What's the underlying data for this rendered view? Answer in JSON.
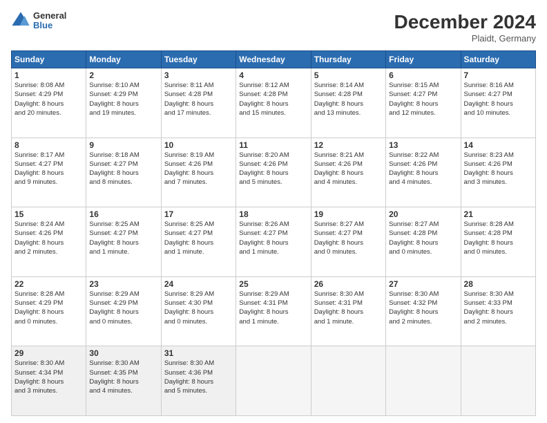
{
  "header": {
    "logo_general": "General",
    "logo_blue": "Blue",
    "month_title": "December 2024",
    "location": "Plaidt, Germany"
  },
  "days_of_week": [
    "Sunday",
    "Monday",
    "Tuesday",
    "Wednesday",
    "Thursday",
    "Friday",
    "Saturday"
  ],
  "weeks": [
    [
      {
        "day": "1",
        "lines": [
          "Sunrise: 8:08 AM",
          "Sunset: 4:29 PM",
          "Daylight: 8 hours",
          "and 20 minutes."
        ]
      },
      {
        "day": "2",
        "lines": [
          "Sunrise: 8:10 AM",
          "Sunset: 4:29 PM",
          "Daylight: 8 hours",
          "and 19 minutes."
        ]
      },
      {
        "day": "3",
        "lines": [
          "Sunrise: 8:11 AM",
          "Sunset: 4:28 PM",
          "Daylight: 8 hours",
          "and 17 minutes."
        ]
      },
      {
        "day": "4",
        "lines": [
          "Sunrise: 8:12 AM",
          "Sunset: 4:28 PM",
          "Daylight: 8 hours",
          "and 15 minutes."
        ]
      },
      {
        "day": "5",
        "lines": [
          "Sunrise: 8:14 AM",
          "Sunset: 4:28 PM",
          "Daylight: 8 hours",
          "and 13 minutes."
        ]
      },
      {
        "day": "6",
        "lines": [
          "Sunrise: 8:15 AM",
          "Sunset: 4:27 PM",
          "Daylight: 8 hours",
          "and 12 minutes."
        ]
      },
      {
        "day": "7",
        "lines": [
          "Sunrise: 8:16 AM",
          "Sunset: 4:27 PM",
          "Daylight: 8 hours",
          "and 10 minutes."
        ]
      }
    ],
    [
      {
        "day": "8",
        "lines": [
          "Sunrise: 8:17 AM",
          "Sunset: 4:27 PM",
          "Daylight: 8 hours",
          "and 9 minutes."
        ]
      },
      {
        "day": "9",
        "lines": [
          "Sunrise: 8:18 AM",
          "Sunset: 4:27 PM",
          "Daylight: 8 hours",
          "and 8 minutes."
        ]
      },
      {
        "day": "10",
        "lines": [
          "Sunrise: 8:19 AM",
          "Sunset: 4:26 PM",
          "Daylight: 8 hours",
          "and 7 minutes."
        ]
      },
      {
        "day": "11",
        "lines": [
          "Sunrise: 8:20 AM",
          "Sunset: 4:26 PM",
          "Daylight: 8 hours",
          "and 5 minutes."
        ]
      },
      {
        "day": "12",
        "lines": [
          "Sunrise: 8:21 AM",
          "Sunset: 4:26 PM",
          "Daylight: 8 hours",
          "and 4 minutes."
        ]
      },
      {
        "day": "13",
        "lines": [
          "Sunrise: 8:22 AM",
          "Sunset: 4:26 PM",
          "Daylight: 8 hours",
          "and 4 minutes."
        ]
      },
      {
        "day": "14",
        "lines": [
          "Sunrise: 8:23 AM",
          "Sunset: 4:26 PM",
          "Daylight: 8 hours",
          "and 3 minutes."
        ]
      }
    ],
    [
      {
        "day": "15",
        "lines": [
          "Sunrise: 8:24 AM",
          "Sunset: 4:26 PM",
          "Daylight: 8 hours",
          "and 2 minutes."
        ]
      },
      {
        "day": "16",
        "lines": [
          "Sunrise: 8:25 AM",
          "Sunset: 4:27 PM",
          "Daylight: 8 hours",
          "and 1 minute."
        ]
      },
      {
        "day": "17",
        "lines": [
          "Sunrise: 8:25 AM",
          "Sunset: 4:27 PM",
          "Daylight: 8 hours",
          "and 1 minute."
        ]
      },
      {
        "day": "18",
        "lines": [
          "Sunrise: 8:26 AM",
          "Sunset: 4:27 PM",
          "Daylight: 8 hours",
          "and 1 minute."
        ]
      },
      {
        "day": "19",
        "lines": [
          "Sunrise: 8:27 AM",
          "Sunset: 4:27 PM",
          "Daylight: 8 hours",
          "and 0 minutes."
        ]
      },
      {
        "day": "20",
        "lines": [
          "Sunrise: 8:27 AM",
          "Sunset: 4:28 PM",
          "Daylight: 8 hours",
          "and 0 minutes."
        ]
      },
      {
        "day": "21",
        "lines": [
          "Sunrise: 8:28 AM",
          "Sunset: 4:28 PM",
          "Daylight: 8 hours",
          "and 0 minutes."
        ]
      }
    ],
    [
      {
        "day": "22",
        "lines": [
          "Sunrise: 8:28 AM",
          "Sunset: 4:29 PM",
          "Daylight: 8 hours",
          "and 0 minutes."
        ]
      },
      {
        "day": "23",
        "lines": [
          "Sunrise: 8:29 AM",
          "Sunset: 4:29 PM",
          "Daylight: 8 hours",
          "and 0 minutes."
        ]
      },
      {
        "day": "24",
        "lines": [
          "Sunrise: 8:29 AM",
          "Sunset: 4:30 PM",
          "Daylight: 8 hours",
          "and 0 minutes."
        ]
      },
      {
        "day": "25",
        "lines": [
          "Sunrise: 8:29 AM",
          "Sunset: 4:31 PM",
          "Daylight: 8 hours",
          "and 1 minute."
        ]
      },
      {
        "day": "26",
        "lines": [
          "Sunrise: 8:30 AM",
          "Sunset: 4:31 PM",
          "Daylight: 8 hours",
          "and 1 minute."
        ]
      },
      {
        "day": "27",
        "lines": [
          "Sunrise: 8:30 AM",
          "Sunset: 4:32 PM",
          "Daylight: 8 hours",
          "and 2 minutes."
        ]
      },
      {
        "day": "28",
        "lines": [
          "Sunrise: 8:30 AM",
          "Sunset: 4:33 PM",
          "Daylight: 8 hours",
          "and 2 minutes."
        ]
      }
    ],
    [
      {
        "day": "29",
        "lines": [
          "Sunrise: 8:30 AM",
          "Sunset: 4:34 PM",
          "Daylight: 8 hours",
          "and 3 minutes."
        ]
      },
      {
        "day": "30",
        "lines": [
          "Sunrise: 8:30 AM",
          "Sunset: 4:35 PM",
          "Daylight: 8 hours",
          "and 4 minutes."
        ]
      },
      {
        "day": "31",
        "lines": [
          "Sunrise: 8:30 AM",
          "Sunset: 4:36 PM",
          "Daylight: 8 hours",
          "and 5 minutes."
        ]
      },
      {
        "day": "",
        "lines": []
      },
      {
        "day": "",
        "lines": []
      },
      {
        "day": "",
        "lines": []
      },
      {
        "day": "",
        "lines": []
      }
    ]
  ]
}
